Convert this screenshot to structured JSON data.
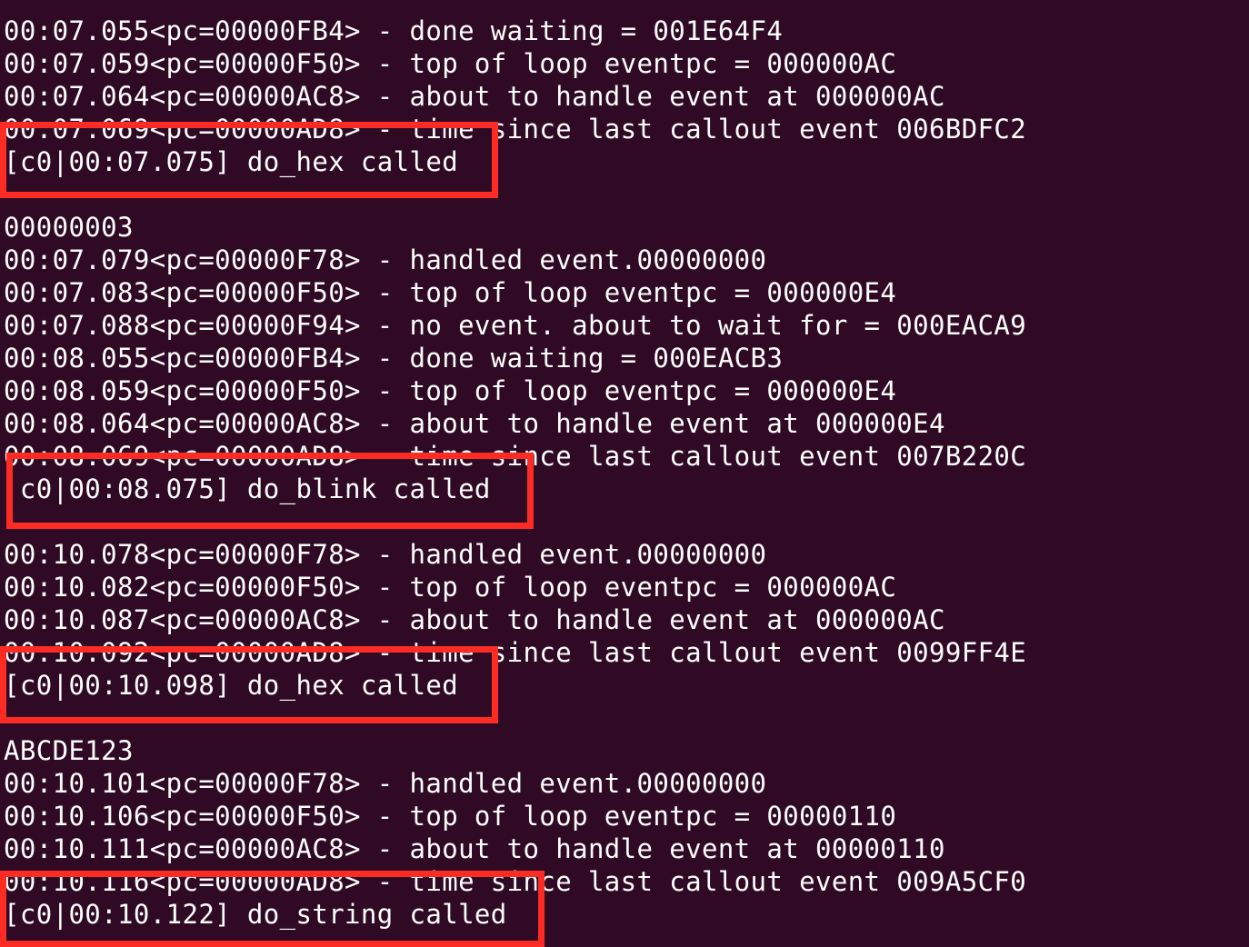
{
  "terminal": {
    "lines": [
      "00:07.055<pc=00000FB4> - done waiting = 001E64F4",
      "00:07.059<pc=00000F50> - top of loop eventpc = 000000AC",
      "00:07.064<pc=00000AC8> - about to handle event at 000000AC",
      "00:07.069<pc=00000AD8> - time since last callout event 006BDFC2",
      "[c0|00:07.075] do_hex called",
      "",
      "00000003",
      "00:07.079<pc=00000F78> - handled event.00000000",
      "00:07.083<pc=00000F50> - top of loop eventpc = 000000E4",
      "00:07.088<pc=00000F94> - no event. about to wait for = 000EACA9",
      "00:08.055<pc=00000FB4> - done waiting = 000EACB3",
      "00:08.059<pc=00000F50> - top of loop eventpc = 000000E4",
      "00:08.064<pc=00000AC8> - about to handle event at 000000E4",
      "00:08.069<pc=00000AD8> - time since last callout event 007B220C",
      " c0|00:08.075] do_blink called",
      "",
      "00:10.078<pc=00000F78> - handled event.00000000",
      "00:10.082<pc=00000F50> - top of loop eventpc = 000000AC",
      "00:10.087<pc=00000AC8> - about to handle event at 000000AC",
      "00:10.092<pc=00000AD8> - time since last callout event 0099FF4E",
      "[c0|00:10.098] do_hex called",
      "",
      "ABCDE123",
      "00:10.101<pc=00000F78> - handled event.00000000",
      "00:10.106<pc=00000F50> - top of loop eventpc = 00000110",
      "00:10.111<pc=00000AC8> - about to handle event at 00000110",
      "00:10.116<pc=00000AD8> - time since last callout event 009A5CF0",
      "[c0|00:10.122] do_string called"
    ],
    "highlight_color": "#fc2b24",
    "background_color": "#300a24",
    "text_color": "#ffffff"
  }
}
